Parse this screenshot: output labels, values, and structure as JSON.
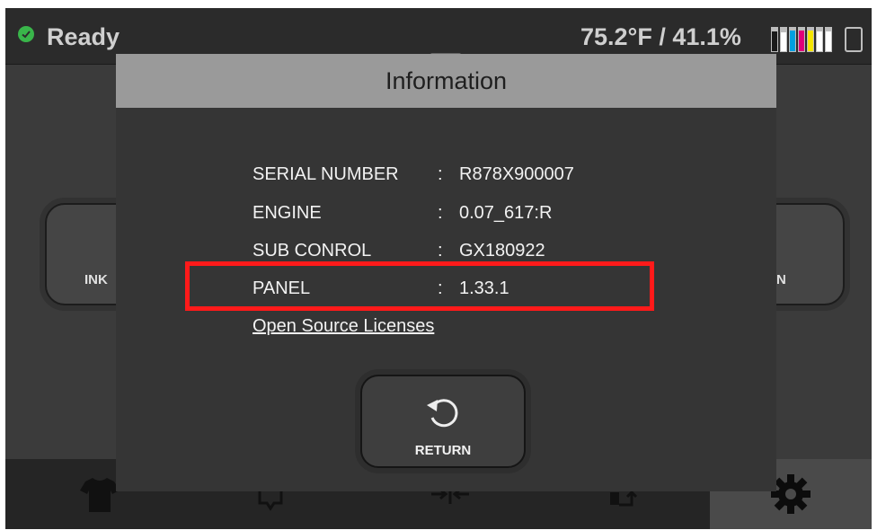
{
  "status": {
    "state": "Ready",
    "state_color": "#39b54a",
    "environment": "75.2°F / 41.1%",
    "ink_levels": [
      {
        "color": "#1a1a1a",
        "level": 0.85
      },
      {
        "color": "#ffffff",
        "level": 0.8
      },
      {
        "color": "#00a0e0",
        "level": 0.9
      },
      {
        "color": "#e0007a",
        "level": 0.9
      },
      {
        "color": "#f5e600",
        "level": 0.9
      },
      {
        "color": "#ffffff",
        "level": 0.85
      },
      {
        "color": "#ffffff",
        "level": 0.85
      }
    ]
  },
  "background_buttons": {
    "left_label": "INK",
    "right_label": "N"
  },
  "bottom_nav": {
    "items": [
      "tshirt-icon",
      "tray-icon",
      "align-icon",
      "eject-icon",
      "gear-icon"
    ]
  },
  "dialog": {
    "title": "Information",
    "rows": [
      {
        "label": "SERIAL NUMBER",
        "sep": ":",
        "value": "R878X900007"
      },
      {
        "label": "ENGINE",
        "sep": ":",
        "value": "0.07_617:R"
      },
      {
        "label": "SUB CONROL",
        "sep": ":",
        "value": "GX180922"
      },
      {
        "label": "PANEL",
        "sep": ":",
        "value": "1.33.1"
      }
    ],
    "highlight_color": "#ff1a1a",
    "link_text": "Open Source Licenses",
    "return_label": "RETURN"
  }
}
